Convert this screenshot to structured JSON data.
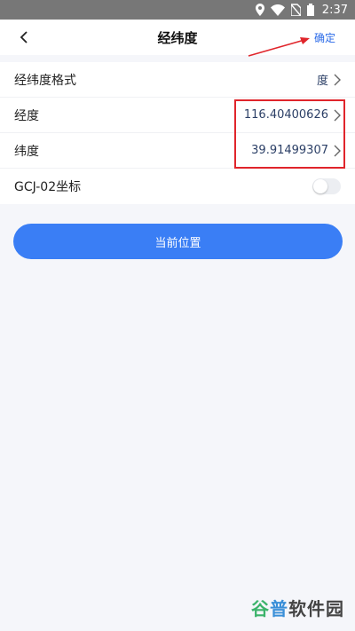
{
  "status_bar": {
    "time": "2:37",
    "icons": [
      "location-icon",
      "wifi-icon",
      "no-sim-icon",
      "battery-icon"
    ]
  },
  "nav": {
    "back_icon": "chevron-left-icon",
    "title": "经纬度",
    "confirm_label": "确定"
  },
  "rows": [
    {
      "label": "经纬度格式",
      "value": "度"
    },
    {
      "label": "经度",
      "value": "116.40400626"
    },
    {
      "label": "纬度",
      "value": "39.91499307"
    }
  ],
  "gcj_row": {
    "label": "GCJ-02坐标",
    "toggle_on": false
  },
  "locate_button": {
    "label": "当前位置"
  },
  "watermark": {
    "part1": "谷",
    "part2": "普",
    "part3": "软件园"
  },
  "colors": {
    "accent": "#3a7ef5",
    "confirm": "#2a6ae8",
    "annotation": "#e0252b",
    "background": "#f5f6fa"
  }
}
